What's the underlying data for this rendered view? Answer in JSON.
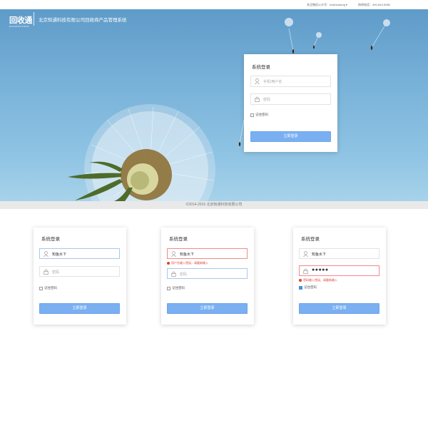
{
  "topbar": {
    "follow_wechat": "关注微信公众号：huishoutong ▾",
    "hotline": "热线电话：400-643-5080"
  },
  "header": {
    "logo_text": "回收通",
    "logo_sub": "HUISHOUTONG",
    "system_title": "北京知通科技有限公司回收商产品管理系统"
  },
  "login_main": {
    "title": "系统登录",
    "username_placeholder": "手机/用户名",
    "password_placeholder": "密码",
    "remember_label": "记住密码",
    "login_button": "立即登录"
  },
  "footer": {
    "copyright": "©2014-2016 北京知通科技有限公司"
  },
  "states": [
    {
      "title": "系统登录",
      "username_value": "知鱼水下",
      "password_placeholder": "密码",
      "remember_label": "记住密码",
      "login_button": "立即登录"
    },
    {
      "title": "系统登录",
      "username_value": "知鱼水下",
      "username_error": "用户名输入错误，请重新输入",
      "password_placeholder": "密码",
      "remember_label": "记住密码",
      "login_button": "立即登录"
    },
    {
      "title": "系统登录",
      "username_value": "知鱼水下",
      "password_value": "●●●●●",
      "password_error": "密码输入错误，请重新输入",
      "remember_label": "记住密码",
      "remember_checked": true,
      "login_button": "立即登录"
    }
  ],
  "colors": {
    "accent_button": "#7ab0f2",
    "error": "#e0413b",
    "focus_border": "#a8c8ea",
    "footer_bg": "#e9e9e9"
  },
  "icons": [
    "user-icon",
    "lock-icon",
    "error-icon",
    "checkbox"
  ]
}
